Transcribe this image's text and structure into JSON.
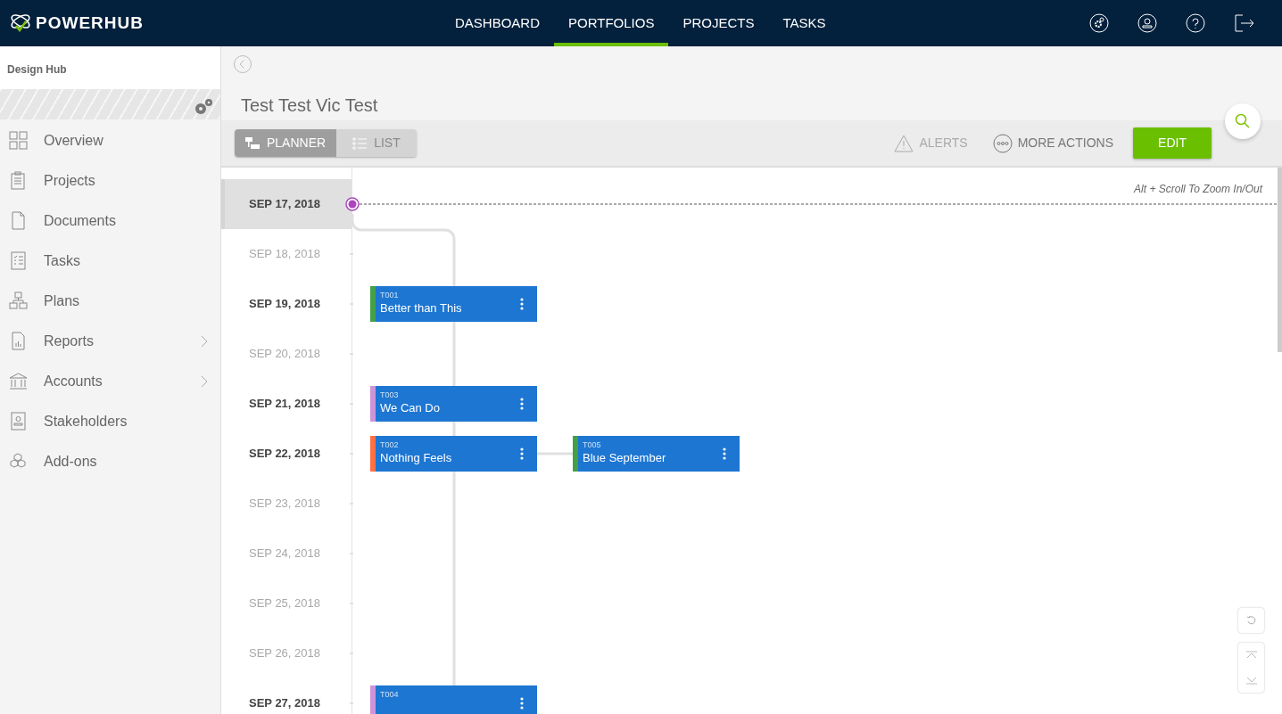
{
  "brand": "POWERHUB",
  "nav": [
    {
      "label": "DASHBOARD",
      "selected": false
    },
    {
      "label": "PORTFOLIOS",
      "selected": true
    },
    {
      "label": "PROJECTS",
      "selected": false
    },
    {
      "label": "TASKS",
      "selected": false
    }
  ],
  "sidebar": {
    "title": "Design Hub",
    "items": [
      {
        "label": "Overview",
        "has_submenu": false
      },
      {
        "label": "Projects",
        "has_submenu": false
      },
      {
        "label": "Documents",
        "has_submenu": false
      },
      {
        "label": "Tasks",
        "has_submenu": false
      },
      {
        "label": "Plans",
        "has_submenu": false
      },
      {
        "label": "Reports",
        "has_submenu": true
      },
      {
        "label": "Accounts",
        "has_submenu": true
      },
      {
        "label": "Stakeholders",
        "has_submenu": false
      },
      {
        "label": "Add-ons",
        "has_submenu": false
      }
    ]
  },
  "page_title": "Test Test Vic Test",
  "view_toggle": [
    {
      "label": "PLANNER",
      "selected": true
    },
    {
      "label": "LIST",
      "selected": false
    }
  ],
  "actions": [
    {
      "label": "ALERTS",
      "disabled": true
    },
    {
      "label": "MORE ACTIONS",
      "disabled": false
    }
  ],
  "edit_button": "EDIT",
  "zoom_hint": "Alt + Scroll To Zoom In/Out",
  "timeline": [
    {
      "date": "SEP 17, 2018",
      "selected": true,
      "active": true
    },
    {
      "date": "SEP 18, 2018",
      "selected": false,
      "active": false
    },
    {
      "date": "SEP 19, 2018",
      "selected": false,
      "active": true,
      "tasks": [
        {
          "id": "T001",
          "title": "Better than This",
          "color": "#43a047"
        }
      ]
    },
    {
      "date": "SEP 20, 2018",
      "selected": false,
      "active": false
    },
    {
      "date": "SEP 21, 2018",
      "selected": false,
      "active": true,
      "tasks": [
        {
          "id": "T003",
          "title": "We Can Do",
          "color": "#ce93d8"
        }
      ]
    },
    {
      "date": "SEP 22, 2018",
      "selected": false,
      "active": true,
      "tasks": [
        {
          "id": "T002",
          "title": "Nothing Feels",
          "color": "#ff7043",
          "successors": [
            {
              "id": "T005",
              "title": "Blue September",
              "color": "#43a047"
            }
          ]
        }
      ]
    },
    {
      "date": "SEP 23, 2018",
      "selected": false,
      "active": false
    },
    {
      "date": "SEP 24, 2018",
      "selected": false,
      "active": false
    },
    {
      "date": "SEP 25, 2018",
      "selected": false,
      "active": false
    },
    {
      "date": "SEP 26, 2018",
      "selected": false,
      "active": false
    },
    {
      "date": "SEP 27, 2018",
      "selected": false,
      "active": true,
      "tasks": [
        {
          "id": "T004",
          "color": "#ce93d8"
        }
      ]
    }
  ]
}
